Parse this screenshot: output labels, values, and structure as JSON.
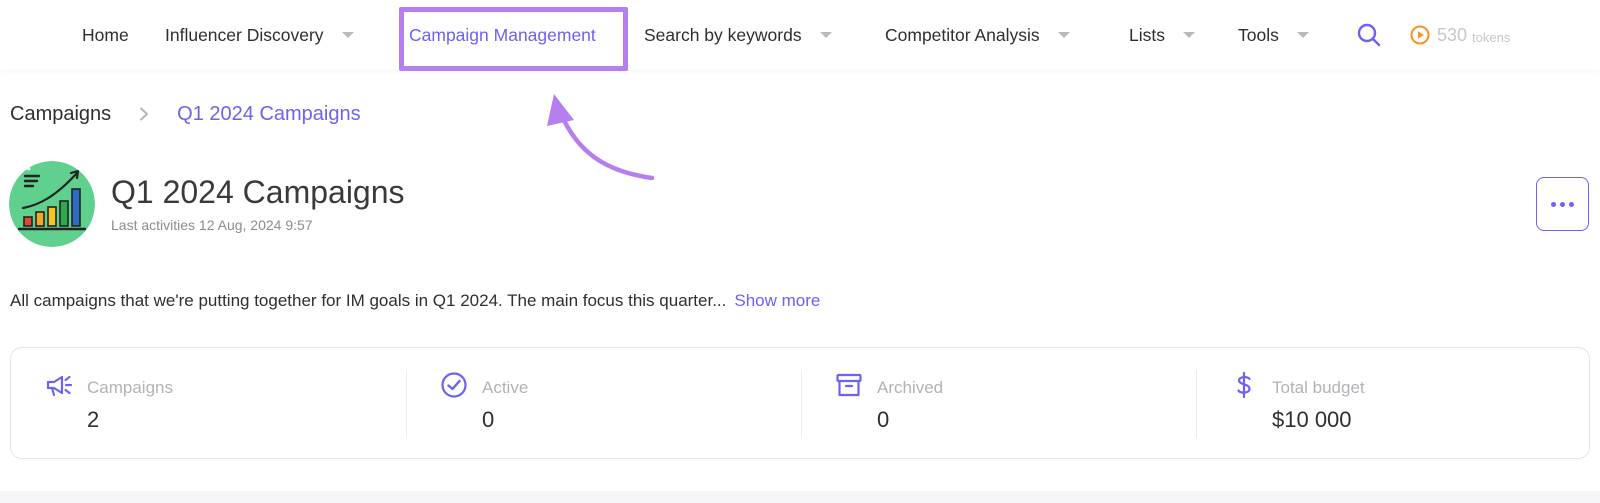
{
  "nav": {
    "items": [
      {
        "label": "Home"
      },
      {
        "label": "Influencer Discovery"
      },
      {
        "label": "Campaign Management"
      },
      {
        "label": "Search by keywords"
      },
      {
        "label": "Competitor Analysis"
      },
      {
        "label": "Lists"
      },
      {
        "label": "Tools"
      }
    ],
    "active": "Campaign Management",
    "tokens": {
      "count": "530",
      "unit": "tokens"
    },
    "icons": {
      "search": "search-icon",
      "tokens": "play-circle-icon"
    },
    "colors": {
      "accent": "#6b63f3",
      "highlight": "#b57ff0",
      "tokens": "#f7931e"
    }
  },
  "breadcrumb": {
    "items": [
      "Campaigns",
      "Q1 2024 Campaigns"
    ]
  },
  "header": {
    "title": "Q1 2024 Campaigns",
    "last_activity": "Last activities 12 Aug, 2024 9:57",
    "avatar_icon": "growth-chart-icon",
    "more_icon": "more-dots-icon"
  },
  "description": {
    "text": "All campaigns that we're putting together for IM goals in Q1 2024. The main focus this quarter...",
    "show_more": "Show more"
  },
  "stats": [
    {
      "label": "Campaigns",
      "value": "2",
      "icon": "megaphone-icon"
    },
    {
      "label": "Active",
      "value": "0",
      "icon": "check-circle-icon"
    },
    {
      "label": "Archived",
      "value": "0",
      "icon": "archive-box-icon"
    },
    {
      "label": "Total budget",
      "value": "$10 000",
      "icon": "dollar-icon"
    }
  ]
}
